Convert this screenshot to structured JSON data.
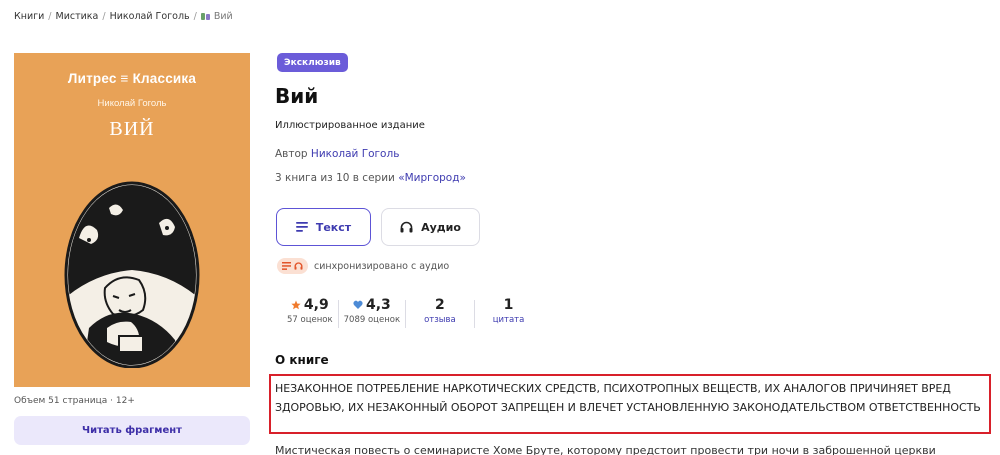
{
  "breadcrumb": {
    "items": [
      "Книги",
      "Мистика",
      "Николай Гоголь"
    ],
    "current": "Вий",
    "separator": "/"
  },
  "cover": {
    "brand": "Литрес ≡ Классика",
    "author": "Николай Гоголь",
    "title": "ВИЙ",
    "background": "#e8a257"
  },
  "volume": "Объем 51 страница · 12+",
  "read_fragment_label": "Читать фрагмент",
  "badge": "Эксклюзив",
  "title": "Вий",
  "subtitle": "Иллюстрированное издание",
  "author": {
    "prefix": "Автор",
    "name": "Николай Гоголь"
  },
  "series": {
    "prefix": "3 книга из 10 в серии",
    "name": "«Миргород»"
  },
  "formats": {
    "text_label": "Текст",
    "audio_label": "Аудио",
    "selected": "Текст"
  },
  "sync_label": "синхронизировано с аудио",
  "stats": {
    "rating_litres": {
      "value": "4,9",
      "sub": "57 оценок"
    },
    "rating_live": {
      "value": "4,3",
      "sub": "7089 оценок"
    },
    "reviews": {
      "value": "2",
      "sub": "отзыва"
    },
    "quotes": {
      "value": "1",
      "sub": "цитата"
    }
  },
  "about": {
    "heading": "О книге",
    "warning": "НЕЗАКОННОЕ ПОТРЕБЛЕНИЕ НАРКОТИЧЕСКИХ СРЕДСТВ, ПСИХОТРОПНЫХ ВЕЩЕСТВ, ИХ АНАЛОГОВ ПРИЧИНЯЕТ ВРЕД ЗДОРОВЬЮ, ИХ НЕЗАКОННЫЙ ОБОРОТ ЗАПРЕЩЕН И ВЛЕЧЕТ УСТАНОВЛЕННУЮ ЗАКОНОДАТЕЛЬСТВОМ ОТВЕТСТВЕННОСТЬ",
    "description": "Мистическая повесть о семинаристе Хоме Бруте, которому предстоит провести три ночи в заброшенной церкви"
  },
  "colors": {
    "accent": "#5d54d6",
    "link": "#3e3bb0",
    "warning_border": "#d8202a",
    "star": "#f07a2c",
    "badge_bg": "#6b5cd9"
  },
  "icons": [
    "book-icon",
    "text-lines-icon",
    "headphones-icon",
    "star-icon",
    "heart-icon"
  ]
}
